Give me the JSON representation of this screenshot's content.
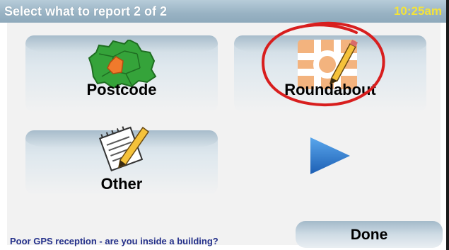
{
  "header": {
    "title": "Select what to report 2 of 2",
    "time": "10:25am"
  },
  "options": [
    {
      "label": "Postcode",
      "icon": "map-region-icon"
    },
    {
      "label": "Roundabout",
      "icon": "roundabout-icon"
    },
    {
      "label": "Other",
      "icon": "notepad-pencil-icon"
    }
  ],
  "next": {
    "icon": "right-arrow-icon"
  },
  "footer": {
    "status": "Poor GPS reception - are you inside a building?",
    "done_label": "Done"
  },
  "colors": {
    "title_bar": "#98b2c3",
    "clock": "#f3e33a",
    "status_text": "#24308a",
    "annotation_circle": "#d81e1e",
    "arrow": "#2f7fd1"
  }
}
